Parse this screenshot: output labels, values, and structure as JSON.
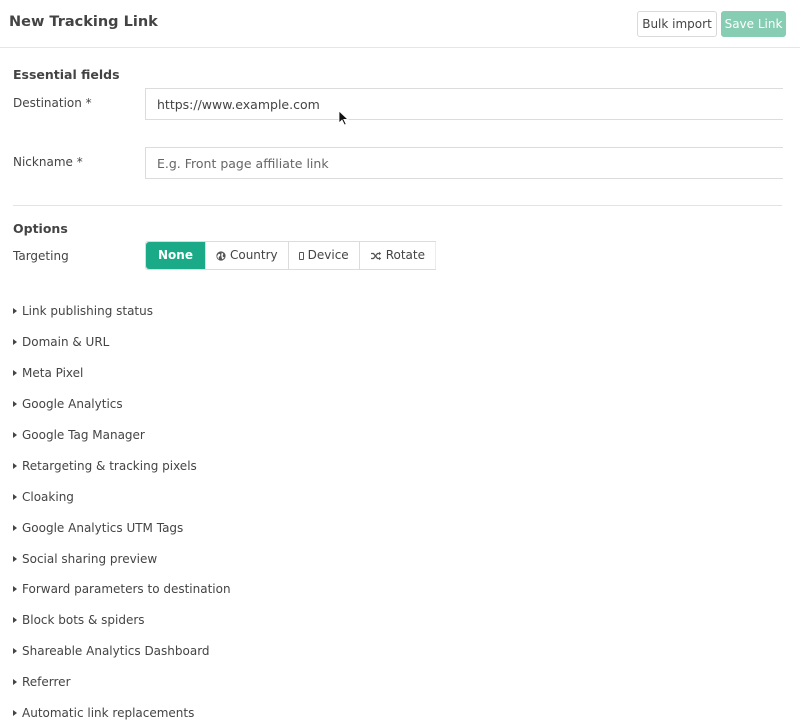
{
  "header": {
    "title": "New Tracking Link",
    "bulk_import_label": "Bulk import",
    "save_label": "Save Link"
  },
  "essential": {
    "title": "Essential fields",
    "destination": {
      "label": "Destination *",
      "value": "https://www.example.com"
    },
    "nickname": {
      "label": "Nickname *",
      "placeholder": "E.g. Front page affiliate link"
    }
  },
  "options": {
    "title": "Options",
    "targeting_label": "Targeting",
    "targeting": [
      {
        "label": "None",
        "icon": "",
        "active": true
      },
      {
        "label": "Country",
        "icon": "globe-icon",
        "active": false
      },
      {
        "label": "Device",
        "icon": "mobile-icon",
        "active": false
      },
      {
        "label": "Rotate",
        "icon": "shuffle-icon",
        "active": false
      }
    ],
    "sections": [
      "Link publishing status",
      "Domain & URL",
      "Meta Pixel",
      "Google Analytics",
      "Google Tag Manager",
      "Retargeting & tracking pixels",
      "Cloaking",
      "Google Analytics UTM Tags",
      "Social sharing preview",
      "Forward parameters to destination",
      "Block bots & spiders",
      "Shareable Analytics Dashboard",
      "Referrer",
      "Automatic link replacements"
    ]
  },
  "colors": {
    "accent": "#1aaa87",
    "save_button": "#86cdb3"
  }
}
